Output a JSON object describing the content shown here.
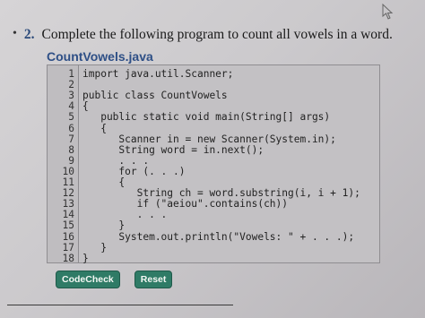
{
  "question": {
    "bullet": "•",
    "number": "2.",
    "text": "Complete the following program to count all vowels in a word."
  },
  "editor": {
    "filename": "CountVowels.java",
    "lines": [
      {
        "n": "1",
        "t": "import java.util.Scanner;"
      },
      {
        "n": "2",
        "t": ""
      },
      {
        "n": "3",
        "t": "public class CountVowels"
      },
      {
        "n": "4",
        "t": "{"
      },
      {
        "n": "5",
        "t": "   public static void main(String[] args)"
      },
      {
        "n": "6",
        "t": "   {"
      },
      {
        "n": "7",
        "t": "      Scanner in = new Scanner(System.in);"
      },
      {
        "n": "8",
        "t": "      String word = in.next();"
      },
      {
        "n": "9",
        "t": "      . . ."
      },
      {
        "n": "10",
        "t": "      for (. . .)"
      },
      {
        "n": "11",
        "t": "      {"
      },
      {
        "n": "12",
        "t": "         String ch = word.substring(i, i + 1);"
      },
      {
        "n": "13",
        "t": "         if (\"aeiou\".contains(ch))"
      },
      {
        "n": "14",
        "t": "         . . ."
      },
      {
        "n": "15",
        "t": "      }"
      },
      {
        "n": "16",
        "t": "      System.out.println(\"Vowels: \" + . . .);"
      },
      {
        "n": "17",
        "t": "   }"
      },
      {
        "n": "18",
        "t": "}"
      }
    ]
  },
  "buttons": {
    "codecheck": "CodeCheck",
    "reset": "Reset"
  },
  "colors": {
    "button": "#2f7b66",
    "filename": "#2e4f86",
    "keyword": "#8a1f6a",
    "string": "#2a3fbf"
  }
}
